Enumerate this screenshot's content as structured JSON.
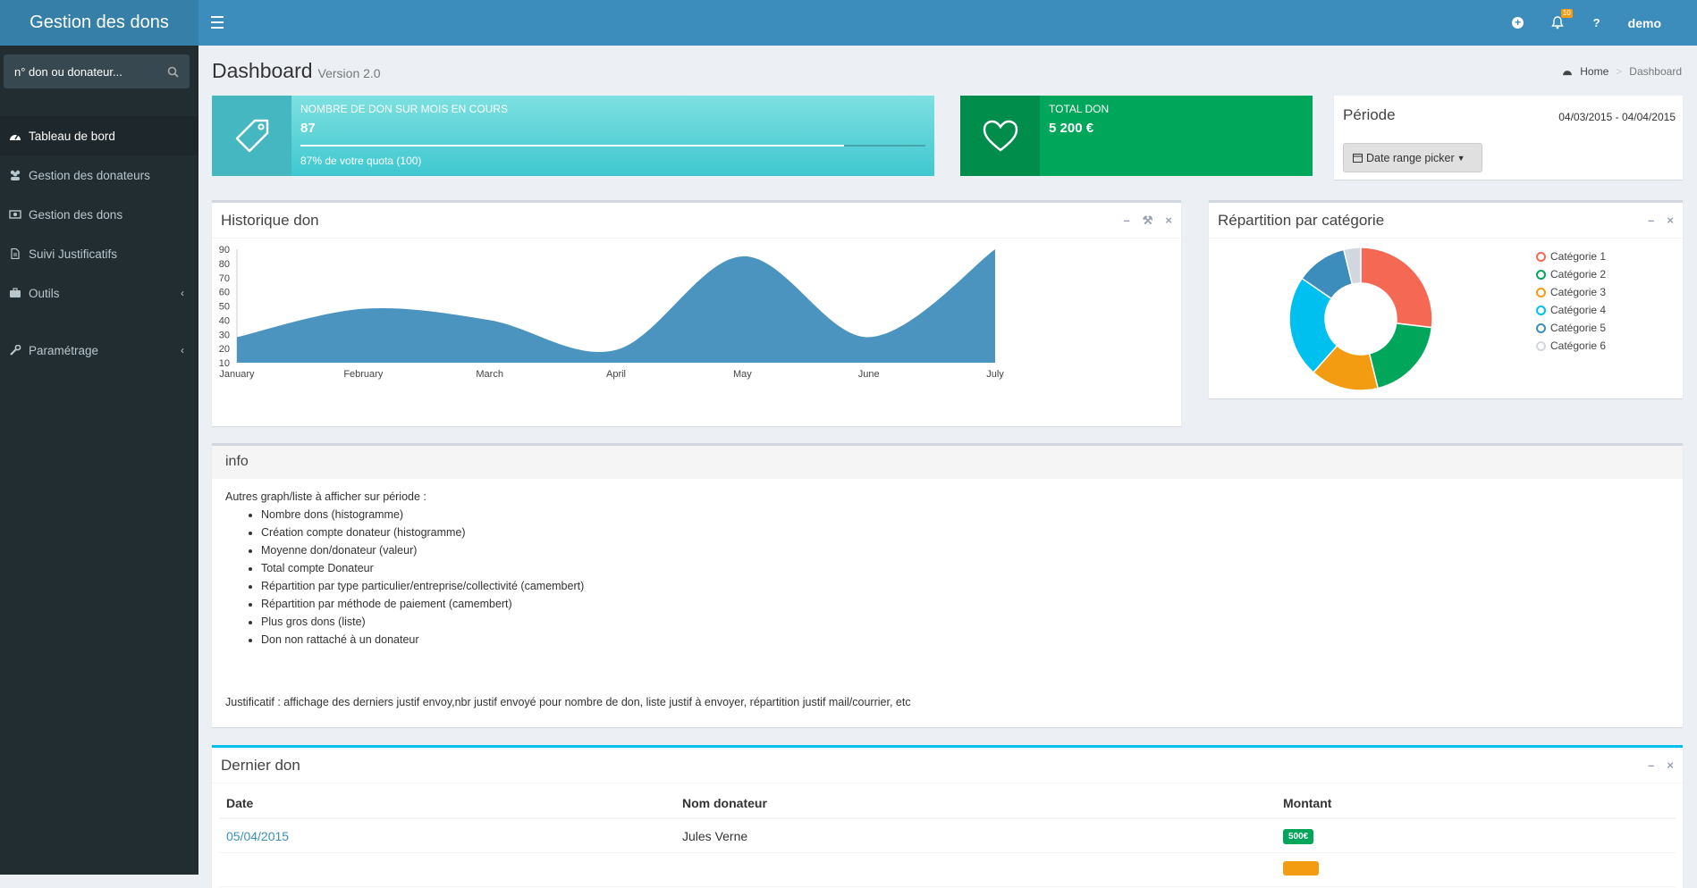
{
  "header": {
    "app_title": "Gestion des dons",
    "badge": "10",
    "user": "demo"
  },
  "sidebar": {
    "search_placeholder": "n° don ou donateur...",
    "items": [
      {
        "label": "Tableau de bord",
        "icon": "dashboard-icon",
        "active": true
      },
      {
        "label": "Gestion des donateurs",
        "icon": "users-icon"
      },
      {
        "label": "Gestion des dons",
        "icon": "money-icon"
      },
      {
        "label": "Suivi Justificatifs",
        "icon": "file-icon"
      },
      {
        "label": "Outils",
        "icon": "briefcase-icon"
      },
      {
        "label": "Paramétrage",
        "icon": "wrench-icon"
      }
    ]
  },
  "page": {
    "title": "Dashboard",
    "version": "Version 2.0",
    "breadcrumb": [
      "Home",
      "Dashboard"
    ]
  },
  "info_boxes": [
    {
      "label": "NOMBRE DE DON SUR MOIS EN COURS",
      "value": "87",
      "progress": 0.87,
      "desc": "87% de votre quota (100)",
      "color": "#5bd2d6",
      "icon_bg": "#45b7c0"
    },
    {
      "label": "TOTAL DON",
      "value": "5 200 €",
      "color": "#00a65a",
      "icon_bg": "#008d4c"
    }
  ],
  "periode": {
    "title": "Période",
    "range": "04/03/2015 - 04/04/2015",
    "button": "Date range picker"
  },
  "historique": {
    "title": "Historique don"
  },
  "repartition": {
    "title": "Répartition par catégorie"
  },
  "info": {
    "title": "info",
    "intro": "Autres graph/liste à afficher sur période :",
    "items": [
      "Nombre dons (histogramme)",
      "Création compte donateur (histogramme)",
      "Moyenne don/donateur (valeur)",
      "Total compte Donateur",
      "Répartition par type particulier/entreprise/collectivité (camembert)",
      "Répartition par méthode de paiement (camembert)",
      "Plus gros dons (liste)",
      "Don non rattaché à un donateur"
    ],
    "footer": "Justificatif : affichage des derniers justif envoy,nbr justif envoyé pour nombre de don, liste justif à envoyer, répartition justif mail/courrier, etc"
  },
  "dernier": {
    "title": "Dernier don",
    "headers": [
      "Date",
      "Nom donateur",
      "Montant"
    ],
    "rows": [
      {
        "date": "05/04/2015",
        "name": "Jules Verne",
        "amount": "500€",
        "color": "#00a65a"
      },
      {
        "date": "",
        "name": "",
        "amount": "",
        "color": "#f39c12"
      }
    ]
  },
  "chart_data": [
    {
      "type": "area",
      "categories": [
        "January",
        "February",
        "March",
        "April",
        "May",
        "June",
        "July"
      ],
      "values": [
        28,
        48,
        40,
        19,
        85,
        28,
        90
      ],
      "ylim": [
        10,
        90
      ],
      "yticks": [
        10,
        20,
        30,
        40,
        50,
        60,
        70,
        80,
        90
      ],
      "color": "#4b94c0"
    },
    {
      "type": "pie",
      "labels": [
        "Catégorie 1",
        "Catégorie 2",
        "Catégorie 3",
        "Catégorie 4",
        "Catégorie 5",
        "Catégorie 6"
      ],
      "values": [
        700,
        500,
        400,
        600,
        300,
        100
      ],
      "colors": [
        "#f56954",
        "#00a65a",
        "#f39c12",
        "#00c0ef",
        "#3c8dbc",
        "#d2d6de"
      ]
    }
  ]
}
